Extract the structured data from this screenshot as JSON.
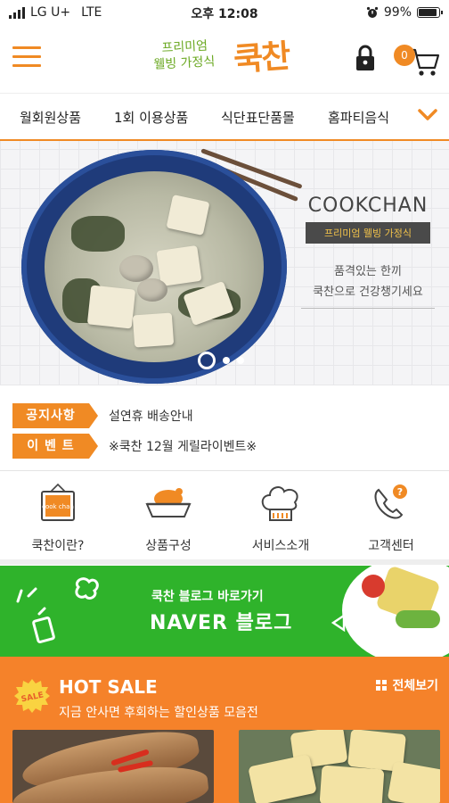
{
  "status_bar": {
    "carrier": "LG U+",
    "network": "LTE",
    "time": "오후 12:08",
    "battery": "99%"
  },
  "header": {
    "logo_small_line1": "프리미엄",
    "logo_small_line2": "웰빙 가정식",
    "logo_big": "쿡찬",
    "cart_count": "0",
    "accent_color": "#f08a24"
  },
  "nav": {
    "items": [
      "월회원상품",
      "1회 이용상품",
      "식단표단품몰",
      "홈파티음식"
    ],
    "more_icon": "chevron-down-icon"
  },
  "banner": {
    "title": "COOKCHAN",
    "subtitle": "프리미엄 웰빙 가정식",
    "line1": "품격있는 한끼",
    "line2": "쿡찬으로 건강챙기세요",
    "slide_count": 3,
    "active_slide": 1
  },
  "notices": [
    {
      "tag": "공지사항",
      "text": "설연휴 배송안내"
    },
    {
      "tag": "이 벤 트",
      "text": "※쿡찬 12월 게릴라이벤트※"
    }
  ],
  "quick_menu": [
    {
      "label": "쿡찬이란?",
      "icon": "cookchan-sign-icon",
      "icon_text": "cook chan"
    },
    {
      "label": "상품구성",
      "icon": "chicken-dish-icon"
    },
    {
      "label": "서비스소개",
      "icon": "chef-hat-icon"
    },
    {
      "label": "고객센터",
      "icon": "phone-question-icon"
    }
  ],
  "naver_banner": {
    "small": "쿡찬 블로그 바로가기",
    "big": "NAVER 블로그",
    "bg_color": "#2fb32b"
  },
  "hot_sale": {
    "badge": "SALE",
    "title": "HOT SALE",
    "subtitle": "지금 안사면 후회하는 할인상품 모음전",
    "view_all": "전체보기",
    "bg_color": "#f5822a"
  }
}
